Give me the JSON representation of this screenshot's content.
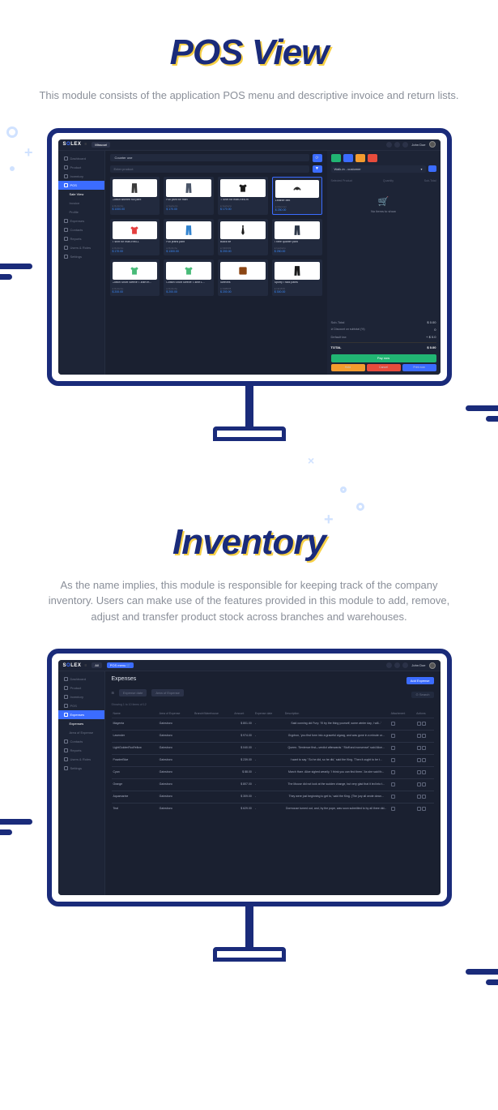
{
  "sections": [
    {
      "title": "POS View",
      "desc": "This module consists of the application POS menu and descriptive invoice and return lists."
    },
    {
      "title": "Inventory",
      "desc": "As the name implies, this module is responsible for keeping track of the company inventory. Users can make use of the features provided in this module to add, remove, adjust and transfer product stock across branches and warehouses."
    }
  ],
  "app": {
    "logo_s": "S",
    "logo_o": "O",
    "logo_rest": "LEX",
    "branch_pill": "Missouri",
    "all_pill": "All",
    "pos_menu_pill": "POS menu",
    "user": "John Doe"
  },
  "pos": {
    "sidebar": [
      {
        "label": "Dashboard",
        "active": false
      },
      {
        "label": "Product",
        "active": false
      },
      {
        "label": "Inventory",
        "active": false
      },
      {
        "label": "POS",
        "active": true
      },
      {
        "label": "Sale View",
        "sub": true,
        "sel": true
      },
      {
        "label": "Invoice",
        "sub": true
      },
      {
        "label": "Profile",
        "sub": true
      },
      {
        "label": "Expenses",
        "active": false
      },
      {
        "label": "Contacts",
        "active": false
      },
      {
        "label": "Reports",
        "active": false
      },
      {
        "label": "Users & Roles",
        "active": false
      },
      {
        "label": "Settings",
        "active": false
      }
    ],
    "counter": "Counter one",
    "search_placeholder": "Enter product",
    "products": [
      {
        "name": "Cotton women full pant",
        "code": "● Rubinho",
        "price": "$ 1000.00",
        "type": "pant",
        "color": "#3b3b3b"
      },
      {
        "name": "Full pant for man",
        "code": "● Iweberto",
        "price": "$ 170.00",
        "type": "pant",
        "color": "#4a5568"
      },
      {
        "name": "T Shirt for man-Red-m",
        "code": "● Iweberto",
        "price": "$ 170.00",
        "type": "tshirt",
        "color": "#1a1a1a"
      },
      {
        "name": "Leather belt",
        "code": "● Manzoni",
        "price": "$ 250.00",
        "type": "belt",
        "color": "#2a2a2a",
        "sel": true
      },
      {
        "name": "T shirt for  man-Red-L",
        "code": "● Rubinho",
        "price": "$ 170.00",
        "type": "tshirt",
        "color": "#e53e3e"
      },
      {
        "name": "Full jeans pant",
        "code": "● Rubinho",
        "price": "$ 1300.00",
        "type": "pant",
        "color": "#3182ce"
      },
      {
        "name": "Black tie",
        "code": "● N40033",
        "price": "$ 200.00",
        "type": "tie",
        "color": "#1a1a1a"
      },
      {
        "name": "Three quarter pant",
        "code": "● Iweberto",
        "price": "$ 250.00",
        "type": "pant",
        "color": "#2d3748"
      },
      {
        "name": "Cotton Short Sleeve T-shirt m...",
        "code": "● Rubinho",
        "price": "$ 200.00",
        "type": "tshirt",
        "color": "#48bb78"
      },
      {
        "name": "Cotton Short Sleeve T-shirt L...",
        "code": "● Rubinho",
        "price": "$ 200.00",
        "type": "tshirt",
        "color": "#48bb78"
      },
      {
        "name": "Sleeves",
        "code": "● N08878",
        "price": "$ 200.00",
        "type": "square",
        "color": "#8b4513"
      },
      {
        "name": "Sporty  Track pants",
        "code": "● N21570",
        "price": "$ 300.00",
        "type": "pant",
        "color": "#1a1a1a"
      }
    ],
    "cart": {
      "customer": "Walk-in - customer",
      "head": [
        "Selected Product",
        "Quantity",
        "Sub-Total"
      ],
      "empty": "No items to show",
      "subtotal_lbl": "Sub-Total",
      "subtotal_val": "$ 0.00",
      "discount_lbl": "Discount on subtotal (%)",
      "discount_val": "0",
      "tax_lbl": "Default tax",
      "tax_val": "+ $ 0.0",
      "total_lbl": "TOTAL",
      "total_val": "$ 0.00",
      "pay_btn": "Pay now",
      "hold": "Hold",
      "cancel": "Cancel",
      "print": "Print now"
    }
  },
  "inv": {
    "sidebar": [
      {
        "label": "Dashboard"
      },
      {
        "label": "Product"
      },
      {
        "label": "Inventory"
      },
      {
        "label": "POS"
      },
      {
        "label": "Expenses",
        "active": true
      },
      {
        "label": "Expenses",
        "sub": true,
        "sel": true
      },
      {
        "label": "Area of Expense",
        "sub": true
      },
      {
        "label": "Contacts"
      },
      {
        "label": "Reports"
      },
      {
        "label": "Users & Roles"
      },
      {
        "label": "Settings"
      }
    ],
    "title": "Expenses",
    "add_btn": "Add Expense",
    "tabs": [
      "All",
      "Expense date",
      "Area of Expense"
    ],
    "search": "Search",
    "showing": "Showing 1 to 10 items of 12",
    "columns": [
      "Name",
      "Area of Expense",
      "Branch/Warehouse",
      "Amount",
      "Expense date",
      "Description",
      "Attachment",
      "Actions"
    ],
    "rows": [
      {
        "name": "Magenta",
        "area": "Gainsboro",
        "amount": "$ 801.00",
        "date": "-",
        "desc": "Said cunning old Fury: 'I'll try the thing yourself, some winter day, I will...'"
      },
      {
        "name": "Lavender",
        "area": "Gainsboro",
        "amount": "$ 974.00",
        "date": "-",
        "desc": "Gryphon, 'you first form into a graceful zigzag, and was gone in a minute or..."
      },
      {
        "name": "LightGoldenRodYellow",
        "area": "Gainsboro",
        "amount": "$ 040.00",
        "date": "-",
        "desc": "Queen. 'Sentence first—verdict afterwards.' 'Stuff and nonsense!' said Alice..."
      },
      {
        "name": "PowderBlue",
        "area": "Gainsboro",
        "amount": "$ 239.00",
        "date": "-",
        "desc": "I want to say.' 'So he did, so he did,' said the King. 'Then it ought to be t..."
      },
      {
        "name": "Cyan",
        "area": "Gainsboro",
        "amount": "$ 88.00",
        "date": "-",
        "desc": "March Hare. Alice sighed wearily. 'I think you can find them.' As she said th..."
      },
      {
        "name": "Orange",
        "area": "Gainsboro",
        "amount": "$ 807.00",
        "date": "-",
        "desc": "The Mouse did not look at the sudden change, but very glad that it led into t..."
      },
      {
        "name": "Aquamarine",
        "area": "Gainsboro",
        "amount": "$ 309.00",
        "date": "-",
        "desc": "They were just beginning to get to,' said the King. (The jury all wrote down..."
      },
      {
        "name": "Teal",
        "area": "Gainsboro",
        "amount": "$ 629.00",
        "date": "-",
        "desc": "Dormouse turned out, and, by the pope, was soon submitted to by all three did..."
      }
    ]
  }
}
